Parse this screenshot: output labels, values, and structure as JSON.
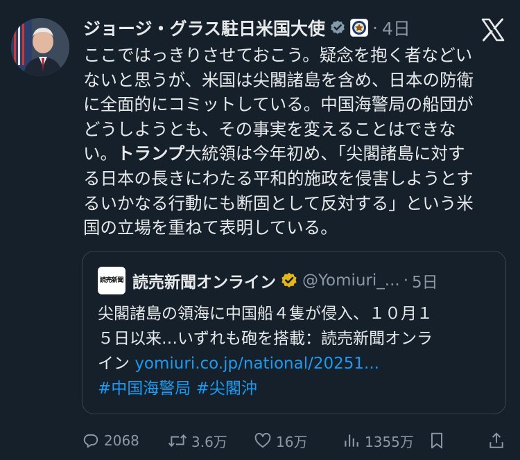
{
  "author": {
    "name": "ジョージ・グラス駐日米国大使",
    "separator": "·",
    "time": "4日"
  },
  "tweet_lines": [
    [
      {
        "t": "ここではっきりさせておこう。疑念を抱く者などい"
      }
    ],
    [
      {
        "t": "ないと思うが、米国は尖閣諸島を含め、日本の防衛"
      }
    ],
    [
      {
        "t": "に全面的にコミットしている。中国海警局の船団が"
      }
    ],
    [
      {
        "t": "どうしようとも、その事実を変えることはできな"
      }
    ],
    [
      {
        "t": "い。"
      },
      {
        "t": "トランプ",
        "b": true
      },
      {
        "t": "大統領は今年初め、「尖閣諸島に対す"
      }
    ],
    [
      {
        "t": "る日本の長きにわたる平和的施政を侵害しようとす"
      }
    ],
    [
      {
        "t": "るいかなる行動にも断固として反対する」という米"
      }
    ],
    [
      {
        "t": "国の立場を重ねて表明している。"
      }
    ]
  ],
  "quote": {
    "logo_text": "読売新聞",
    "name": "読売新聞オンライン",
    "handle": "@Yomiuri_...",
    "separator": "·",
    "time": "5日",
    "text_line1": "尖閣諸島の領海に中国船４隻が侵入、１０月１",
    "text_line2": "５日以来…いずれも砲を搭載：読売新聞オンラ",
    "text_line3_prefix": "イン ",
    "link": "yomiuri.co.jp/national/20251...",
    "hashtags": "#中国海警局 #尖閣沖"
  },
  "actions": {
    "replies": "2068",
    "reposts": "3.6万",
    "likes": "16万",
    "views": "1355万"
  },
  "icons": {
    "verified": "verified-badge-icon",
    "affiliation": "us-embassy-seal-icon",
    "x_logo": "x-logo-icon",
    "gold_check": "gold-verified-badge-icon",
    "reply": "reply-icon",
    "repost": "repost-icon",
    "like": "heart-icon",
    "views": "views-icon",
    "bookmark": "bookmark-icon",
    "share": "share-icon"
  },
  "colors": {
    "background": "#15202b",
    "text": "#e7e9ea",
    "muted": "#8b98a5",
    "link": "#1d9bf0",
    "gold": "#e2b719",
    "border": "#38444d"
  }
}
